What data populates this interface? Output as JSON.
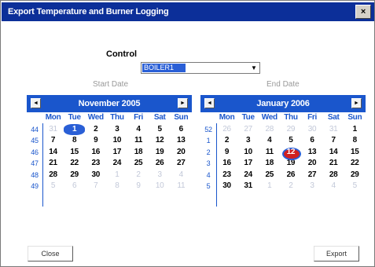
{
  "window": {
    "title": "Export Temperature and Burner Logging",
    "close_label": "×"
  },
  "control": {
    "label": "Control",
    "value": "BOILER1",
    "arrow_icon": "▼"
  },
  "start_calendar": {
    "caption": "Start Date",
    "month_label": "November 2005",
    "prev_icon": "◄",
    "next_icon": "►",
    "days_of_week": [
      "Mon",
      "Tue",
      "Wed",
      "Thu",
      "Fri",
      "Sat",
      "Sun"
    ],
    "week_numbers": [
      "44",
      "45",
      "46",
      "47",
      "48",
      "49"
    ],
    "weeks": [
      [
        "31",
        "1",
        "2",
        "3",
        "4",
        "5",
        "6"
      ],
      [
        "7",
        "8",
        "9",
        "10",
        "11",
        "12",
        "13"
      ],
      [
        "14",
        "15",
        "16",
        "17",
        "18",
        "19",
        "20"
      ],
      [
        "21",
        "22",
        "23",
        "24",
        "25",
        "26",
        "27"
      ],
      [
        "28",
        "29",
        "30",
        "1",
        "2",
        "3",
        "4"
      ],
      [
        "5",
        "6",
        "7",
        "8",
        "9",
        "10",
        "11"
      ]
    ],
    "selected": "1"
  },
  "end_calendar": {
    "caption": "End Date",
    "month_label": "January 2006",
    "prev_icon": "◄",
    "next_icon": "►",
    "days_of_week": [
      "Mon",
      "Tue",
      "Wed",
      "Thu",
      "Fri",
      "Sat",
      "Sun"
    ],
    "week_numbers": [
      "52",
      "1",
      "2",
      "3",
      "4",
      "5"
    ],
    "weeks": [
      [
        "26",
        "27",
        "28",
        "29",
        "30",
        "31",
        "1"
      ],
      [
        "2",
        "3",
        "4",
        "5",
        "6",
        "7",
        "8"
      ],
      [
        "9",
        "10",
        "11",
        "12",
        "13",
        "14",
        "15"
      ],
      [
        "16",
        "17",
        "18",
        "19",
        "20",
        "21",
        "22"
      ],
      [
        "23",
        "24",
        "25",
        "26",
        "27",
        "28",
        "29"
      ],
      [
        "30",
        "31",
        "1",
        "2",
        "3",
        "4",
        "5"
      ]
    ],
    "today": "12"
  },
  "buttons": {
    "close_label": "Close",
    "export_label": "Export"
  }
}
